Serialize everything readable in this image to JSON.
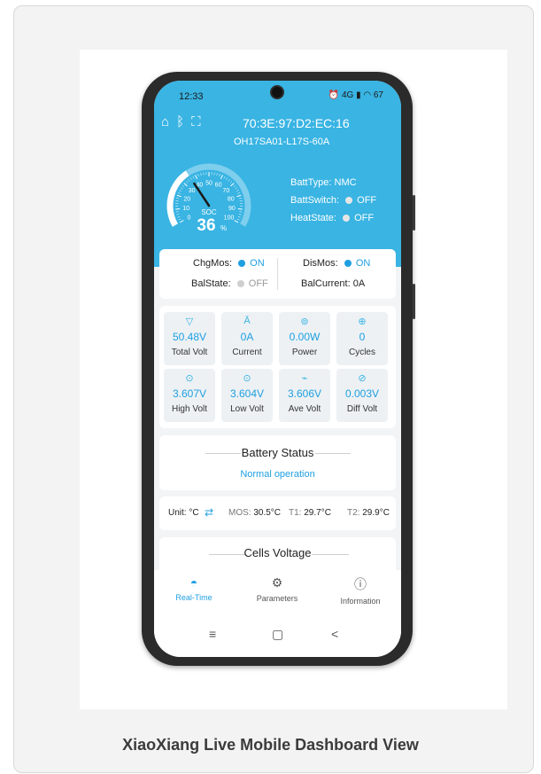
{
  "caption": "XiaoXiang Live Mobile Dashboard View",
  "status_bar": {
    "time": "12:33",
    "icons": "⏰ 4G ▮ ◠ 67"
  },
  "header": {
    "mac": "70:3E:97:D2:EC:16",
    "model": "OH17SA01-L17S-60A"
  },
  "gauge": {
    "label": "SOC",
    "value": "36",
    "unit": "%",
    "soc_percent": 36,
    "ticks": [
      "0",
      "10",
      "20",
      "30",
      "40",
      "50",
      "60",
      "70",
      "80",
      "90",
      "100"
    ]
  },
  "batt_info": [
    {
      "label": "BattType:",
      "value": "NMC",
      "dot": false
    },
    {
      "label": "BattSwitch:",
      "value": "OFF",
      "dot": true
    },
    {
      "label": "HeatState:",
      "value": "OFF",
      "dot": true
    }
  ],
  "mos": {
    "chg_label": "ChgMos:",
    "chg_value": "ON",
    "dis_label": "DisMos:",
    "dis_value": "ON",
    "bal_label": "BalState:",
    "bal_value": "OFF",
    "balcur_label": "BalCurrent:",
    "balcur_value": "0A"
  },
  "metrics": [
    {
      "value": "50.48V",
      "label": "Total Volt",
      "icon": "voltage-icon",
      "glyph": "▽"
    },
    {
      "value": "0A",
      "label": "Current",
      "icon": "current-icon",
      "glyph": "Ā"
    },
    {
      "value": "0.00W",
      "label": "Power",
      "icon": "power-icon",
      "glyph": "⊚"
    },
    {
      "value": "0",
      "label": "Cycles",
      "icon": "cycles-icon",
      "glyph": "⊕"
    },
    {
      "value": "3.607V",
      "label": "High Volt",
      "icon": "high-volt-icon",
      "glyph": "⊙"
    },
    {
      "value": "3.604V",
      "label": "Low Volt",
      "icon": "low-volt-icon",
      "glyph": "⊙"
    },
    {
      "value": "3.606V",
      "label": "Ave Volt",
      "icon": "ave-volt-icon",
      "glyph": "⌁"
    },
    {
      "value": "0.003V",
      "label": "Diff Volt",
      "icon": "diff-volt-icon",
      "glyph": "⊘"
    }
  ],
  "battery_status": {
    "title": "Battery Status",
    "value": "Normal operation"
  },
  "temps": {
    "unit_label": "Unit: °C",
    "swap_icon": "⇄",
    "mos_label": "MOS:",
    "mos_value": "30.5°C",
    "t1_label": "T1:",
    "t1_value": "29.7°C",
    "t2_label": "T2:",
    "t2_value": "29.9°C"
  },
  "cells": {
    "title": "Cells Voltage"
  },
  "tabs": [
    {
      "label": "Real-Time",
      "icon": "speedometer-icon",
      "glyph": "◓",
      "active": true
    },
    {
      "label": "Parameters",
      "icon": "gear-icon",
      "glyph": "⚙",
      "active": false
    },
    {
      "label": "Information",
      "icon": "info-icon",
      "glyph": "ⓘ",
      "active": false
    }
  ],
  "navbar": {
    "menu": "≡",
    "home": "▢",
    "back": "<"
  },
  "colors": {
    "header": "#39b4e3",
    "accent": "#1e9fe0",
    "on_dot": "#1e9fe0",
    "off_dot": "#cfcfcf"
  }
}
